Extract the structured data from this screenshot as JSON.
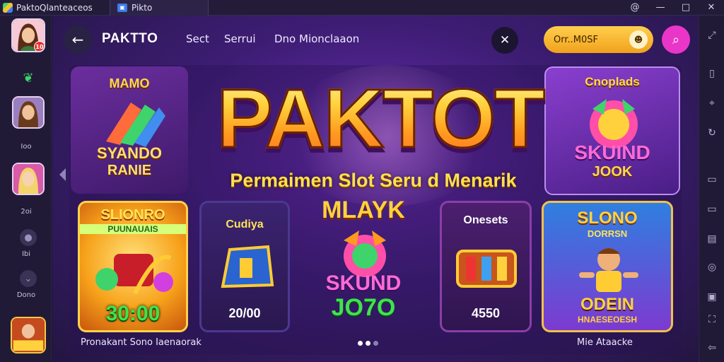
{
  "titlebar": {
    "app_name": "PaktoQlanteaceos",
    "tab_label": "Pikto",
    "controls": [
      "@",
      "—",
      "□",
      "✕"
    ]
  },
  "leftbar": {
    "labels": [
      "Ioo",
      "2oi",
      "Ibi",
      "Dono"
    ]
  },
  "header": {
    "brand": "PAKTTO",
    "nav": [
      "Sect",
      "Serrui",
      "Dno Mionclaaon"
    ],
    "search_pill_text": "Orr..M0SF"
  },
  "hero": {
    "title": "PAKTOT",
    "subtitle": "Permaimen Slot Seru d Menarik"
  },
  "tiles": {
    "left_top": {
      "title": "MAMO",
      "art_text": [
        "SYANDO",
        "RANIE"
      ]
    },
    "right_top": {
      "title": "Cnoplads",
      "art_text": [
        "SKUIND",
        "JOOK"
      ]
    }
  },
  "cards": [
    {
      "name": "SLIONRO",
      "sub": "PUUNAUAIS",
      "value": "30:00"
    },
    {
      "name": "Cudiya",
      "value": "20/00"
    },
    {
      "name": "MLAYK",
      "art_text": [
        "SKUND",
        "JO7O"
      ]
    },
    {
      "name": "Onesets",
      "value": "4550"
    },
    {
      "name": "SLONO",
      "sub": "DORRSN",
      "value": "ODEIN",
      "value2": "HNAESEOESH"
    }
  ],
  "footer": {
    "left": "Pronakant Sono Iaenaorak",
    "right": "Mie Ataacke"
  },
  "colors": {
    "accent_gold": "#ffd23d",
    "pill_gold": "#f1a11c",
    "user_pink": "#e936c9",
    "bg_purple": "#3d1d74"
  }
}
